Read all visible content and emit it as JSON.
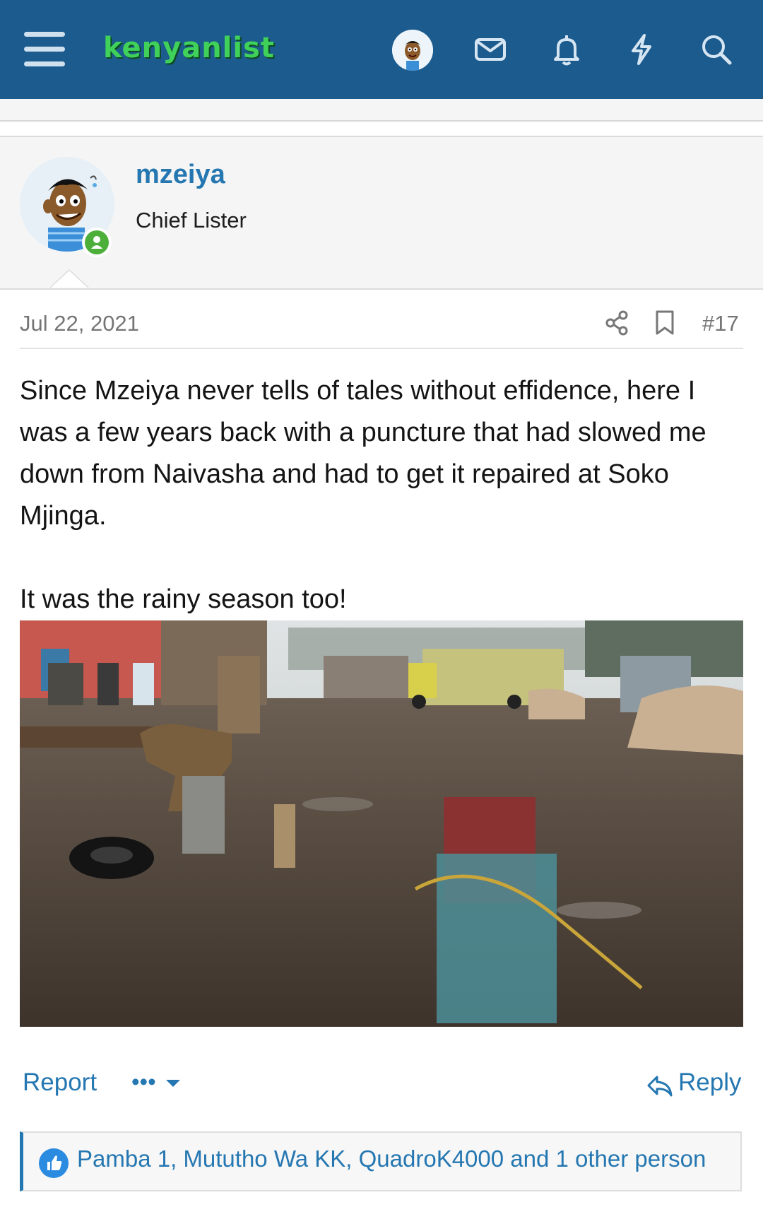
{
  "header": {
    "logo_text": "kenyanlist",
    "brand_color": "#1c5b8e",
    "logo_color": "#3fd15a",
    "icons": [
      "menu-icon",
      "user-avatar",
      "envelope-icon",
      "bell-icon",
      "lightning-icon",
      "search-icon"
    ]
  },
  "post": {
    "username": "mzeiya",
    "user_title": "Chief Lister",
    "online": true,
    "date": "Jul 22, 2021",
    "post_number": "#17",
    "paragraphs": [
      "Since Mzeiya never tells of tales without effidence, here I was a few years back with a puncture that had slowed me down from Naivasha and had to get it repaired at Soko Mjinga.",
      "It was the rainy season too!"
    ],
    "image_description_icon": "photo"
  },
  "actions": {
    "report_label": "Report",
    "more_label": "•••",
    "reply_label": "Reply"
  },
  "reactions": {
    "text": "Pamba 1, Mututho Wa KK, QuadroK4000 and 1 other person"
  }
}
